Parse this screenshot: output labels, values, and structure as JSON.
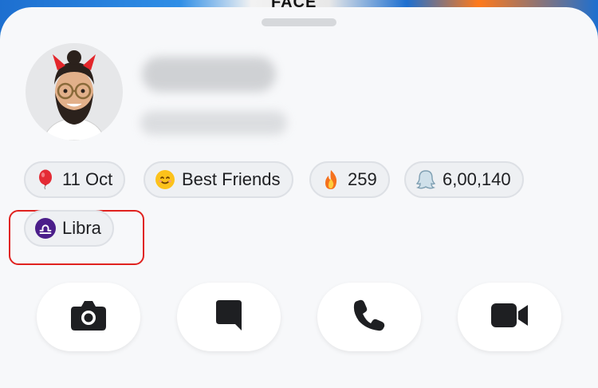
{
  "background": {
    "partial_text": "FACE"
  },
  "profile": {
    "avatar_icon": "bitmoji-avatar"
  },
  "chips": {
    "birthday": {
      "label": "11 Oct",
      "icon": "balloon-icon"
    },
    "friendship": {
      "label": "Best Friends",
      "icon": "smiley-icon"
    },
    "streak": {
      "label": "259",
      "icon": "fire-icon"
    },
    "score": {
      "label": "6,00,140",
      "icon": "ghost-icon"
    },
    "zodiac": {
      "label": "Libra",
      "icon": "libra-icon"
    }
  },
  "actions": [
    {
      "name": "camera",
      "icon": "camera-icon"
    },
    {
      "name": "chat",
      "icon": "chat-icon"
    },
    {
      "name": "voice-call",
      "icon": "phone-icon"
    },
    {
      "name": "video-call",
      "icon": "video-icon"
    }
  ],
  "colors": {
    "highlight_border": "#e0221f",
    "zodiac_badge": "#4b1e8a",
    "sheet_background": "#f7f8fa",
    "chip_background": "#eef0f3"
  }
}
